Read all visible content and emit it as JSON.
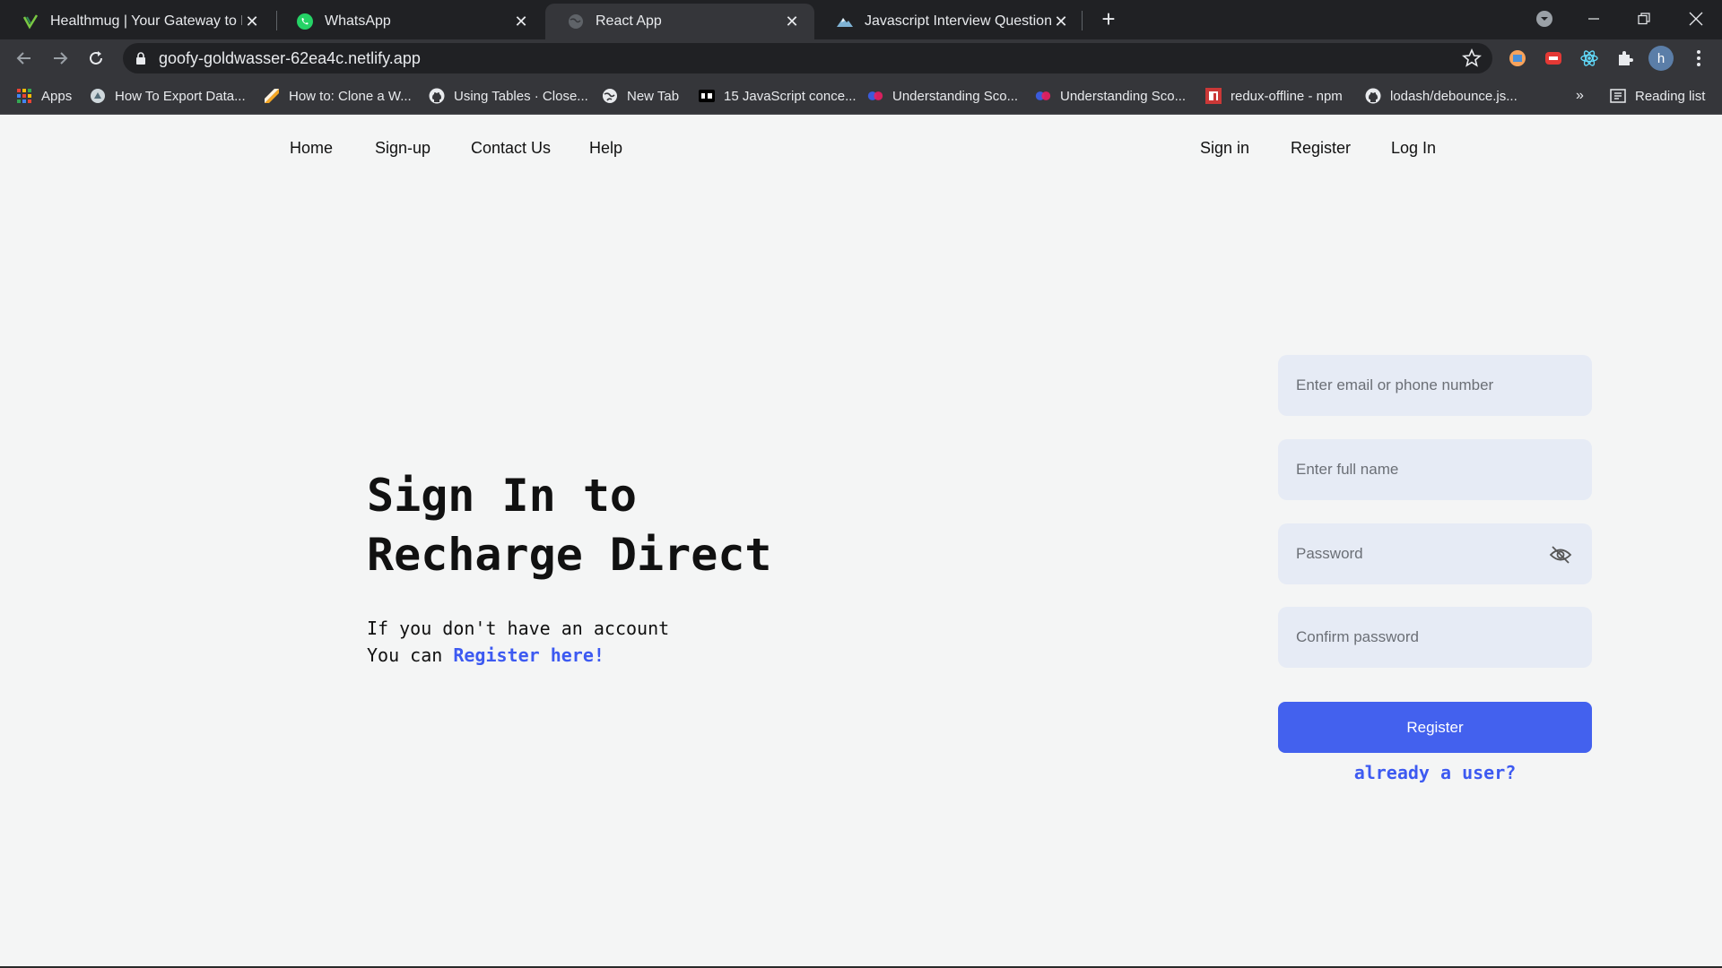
{
  "browser": {
    "tabs": [
      {
        "title": "Healthmug | Your Gateway to He",
        "icon": "healthmug-icon"
      },
      {
        "title": "WhatsApp",
        "icon": "whatsapp-icon"
      },
      {
        "title": "React App",
        "icon": "globe-icon",
        "active": true
      },
      {
        "title": "Javascript Interview Questions an",
        "icon": "mountain-icon"
      }
    ],
    "url": "goofy-goldwasser-62ea4c.netlify.app",
    "profile_initial": "h",
    "bookmarks": [
      {
        "label": "Apps",
        "icon": "apps-grid-icon"
      },
      {
        "label": "How To Export Data...",
        "icon": "export-icon"
      },
      {
        "label": "How to: Clone a W...",
        "icon": "clone-icon"
      },
      {
        "label": "Using Tables · Close...",
        "icon": "github-icon"
      },
      {
        "label": "New Tab",
        "icon": "globe-icon"
      },
      {
        "label": "15 JavaScript conce...",
        "icon": "dev-icon"
      },
      {
        "label": "Understanding Sco...",
        "icon": "hashnode-icon"
      },
      {
        "label": "Understanding Sco...",
        "icon": "hashnode-icon"
      },
      {
        "label": "redux-offline - npm",
        "icon": "npm-icon"
      },
      {
        "label": "lodash/debounce.js...",
        "icon": "github-icon"
      }
    ],
    "overflow": "»",
    "reading_list": "Reading list"
  },
  "nav": {
    "left": [
      "Home",
      "Sign-up",
      "Contact Us",
      "Help"
    ],
    "right": [
      "Sign in",
      "Register",
      "Log In"
    ]
  },
  "hero": {
    "title_line1": "Sign In to",
    "title_line2": "Recharge Direct",
    "sub_line1": "If you don't have an account",
    "sub_line2_prefix": "You can ",
    "register_link": "Register here!"
  },
  "form": {
    "email_placeholder": "Enter email or phone number",
    "name_placeholder": "Enter full name",
    "password_placeholder": "Password",
    "confirm_placeholder": "Confirm password",
    "submit_label": "Register",
    "already_link": "already a user?"
  },
  "colors": {
    "accent": "#4361ee",
    "field_bg": "#e6ebf5",
    "page_bg": "#f4f5f5",
    "chrome_dark": "#202124",
    "chrome_mid": "#35363a"
  }
}
